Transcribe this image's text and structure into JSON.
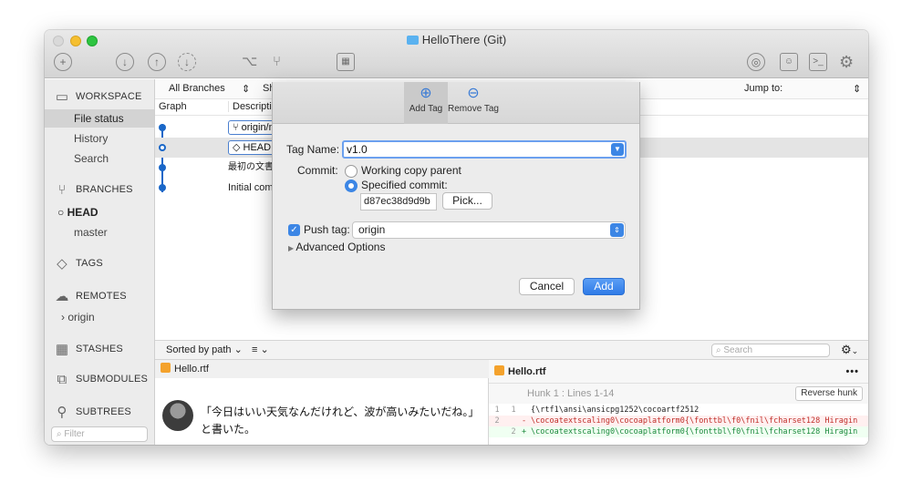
{
  "window": {
    "title": "HelloThere (Git)"
  },
  "toolbar": {
    "add_icon": "+",
    "fetch_icon": "↓",
    "push_icon": "↑",
    "pull_icon": "↓",
    "branch_icon": "branch",
    "merge_icon": "merge",
    "stash_icon": "stash",
    "remote_icon": "globe",
    "finder_icon": "finder",
    "terminal_icon": ">_",
    "settings_icon": "⚙"
  },
  "sidebar": {
    "workspace": "WORKSPACE",
    "workspace_items": [
      "File status",
      "History",
      "Search"
    ],
    "branches": "BRANCHES",
    "branch_items": [
      "HEAD",
      "master"
    ],
    "tags": "TAGS",
    "remotes": "REMOTES",
    "remote_items": [
      "origin"
    ],
    "stashes": "STASHES",
    "submodules": "SUBMODULES",
    "subtrees": "SUBTREES",
    "filter_placeholder": "Filter"
  },
  "commits": {
    "branch_filter": "All Branches",
    "show_label": "Sh",
    "jump_to": "Jump to:",
    "col_graph": "Graph",
    "col_description": "Descriptio",
    "rows": [
      {
        "badge": "origin/m",
        "text": ""
      },
      {
        "badge": "HEAD",
        "text": ""
      },
      {
        "badge": "",
        "text": "最初の文書"
      },
      {
        "badge": "",
        "text": "Initial com"
      }
    ]
  },
  "file_bar": {
    "sort_label": "Sorted by path",
    "view_label": "≡",
    "search_placeholder": "Search",
    "gear": "⚙"
  },
  "files": {
    "name": "Hello.rtf",
    "preview": "「今日はいい天気なんだけれど、波が高いみたいだね。」と書いた。"
  },
  "diff": {
    "file": "Hello.rtf",
    "more": "•••",
    "hunk": "Hunk 1 : Lines 1-14",
    "reverse": "Reverse hunk",
    "lines": [
      {
        "old": "1",
        "new": "1",
        "type": "ctx",
        "sign": "",
        "text": "{\\rtf1\\ansi\\ansicpg1252\\cocoartf2512"
      },
      {
        "old": "2",
        "new": "",
        "type": "del",
        "sign": "-",
        "text": "\\cocoatextscaling0\\cocoaplatform0{\\fonttbl\\f0\\fnil\\fcharset128 Hiragin"
      },
      {
        "old": "",
        "new": "2",
        "type": "add",
        "sign": "+",
        "text": "\\cocoatextscaling0\\cocoaplatform0{\\fonttbl\\f0\\fnil\\fcharset128 Hiragin"
      }
    ]
  },
  "dialog": {
    "tab_add": "Add Tag",
    "tab_remove": "Remove Tag",
    "tag_name_label": "Tag Name:",
    "tag_name_value": "v1.0",
    "commit_label": "Commit:",
    "working_copy": "Working copy parent",
    "specified_commit": "Specified commit:",
    "sha": "d87ec38d9d9b",
    "pick": "Pick...",
    "push_tag_label": "Push tag:",
    "remote": "origin",
    "advanced": "Advanced Options",
    "cancel": "Cancel",
    "add": "Add"
  },
  "colors": {
    "accent": "#3c86e5",
    "graph": "#1a67c8",
    "del": "#c0302b",
    "add": "#1d8a3e"
  }
}
